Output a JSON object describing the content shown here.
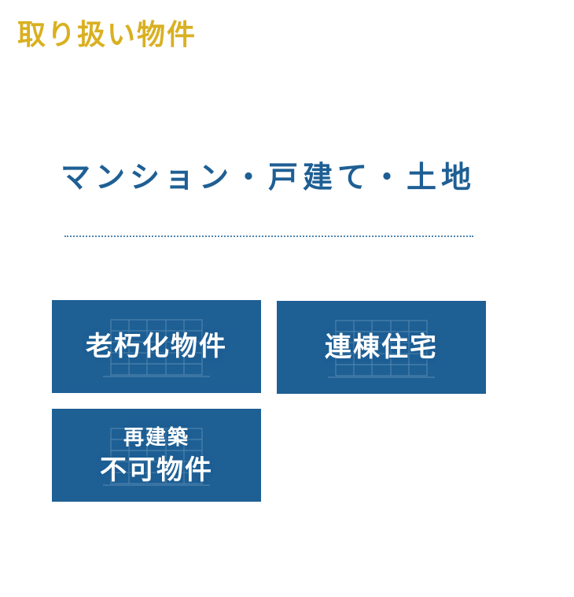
{
  "section": {
    "title": "取り扱い物件"
  },
  "category": {
    "heading": "マンション・戸建て・土地"
  },
  "cards": [
    {
      "label": "老朽化物件"
    },
    {
      "label": "連棟住宅"
    },
    {
      "label_line1": "再建築",
      "label_line2": "不可物件"
    }
  ],
  "colors": {
    "accent_gold": "#d9b021",
    "brand_blue": "#1e5f94",
    "card_text": "#ffffff"
  },
  "icons": {
    "card_background": "building-icon"
  }
}
